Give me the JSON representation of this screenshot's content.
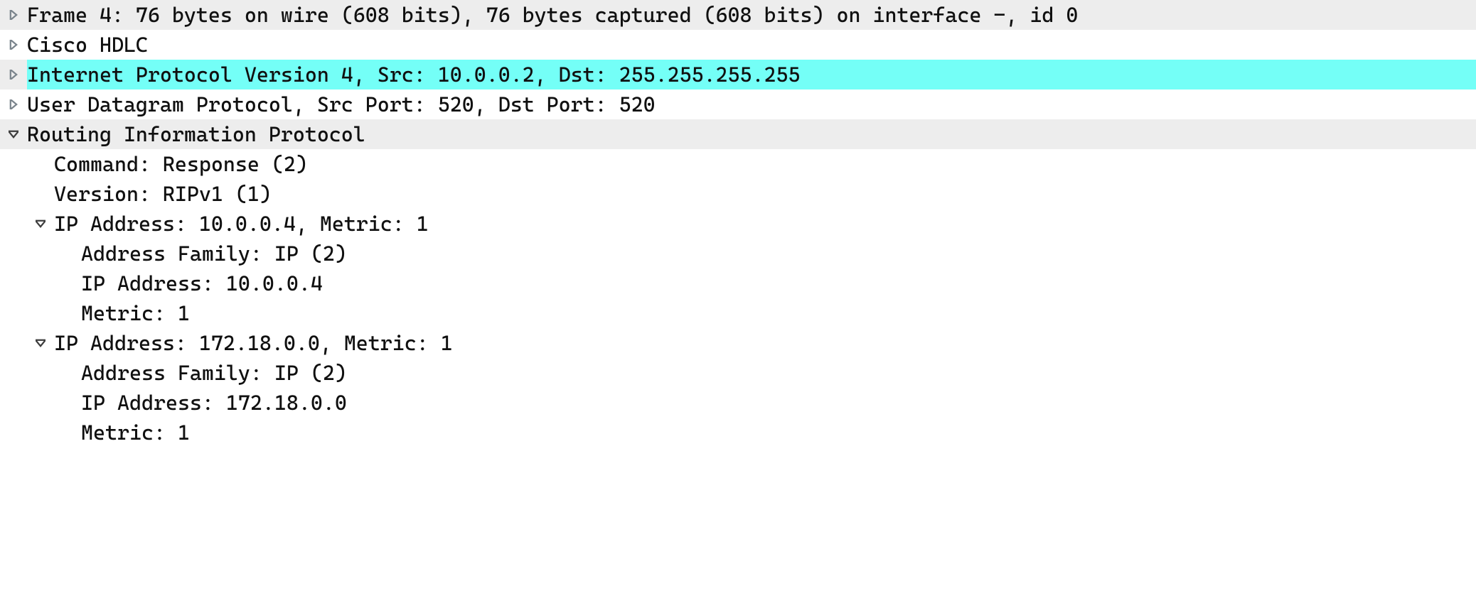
{
  "frame": {
    "summary": "Frame 4: 76 bytes on wire (608 bits), 76 bytes captured (608 bits) on interface -, id 0"
  },
  "l2": {
    "summary": "Cisco HDLC"
  },
  "ip": {
    "summary": "Internet Protocol Version 4, Src: 10.0.0.2, Dst: 255.255.255.255"
  },
  "udp": {
    "summary": "User Datagram Protocol, Src Port: 520, Dst Port: 520"
  },
  "rip": {
    "summary": "Routing Information Protocol",
    "command": "Command: Response (2)",
    "version": "Version: RIPv1 (1)",
    "routes": [
      {
        "summary": "IP Address: 10.0.0.4, Metric: 1",
        "family": "Address Family: IP (2)",
        "addr": "IP Address: 10.0.0.4",
        "metric": "Metric: 1"
      },
      {
        "summary": "IP Address: 172.18.0.0, Metric: 1",
        "family": "Address Family: IP (2)",
        "addr": "IP Address: 172.18.0.0",
        "metric": "Metric: 1"
      }
    ]
  }
}
